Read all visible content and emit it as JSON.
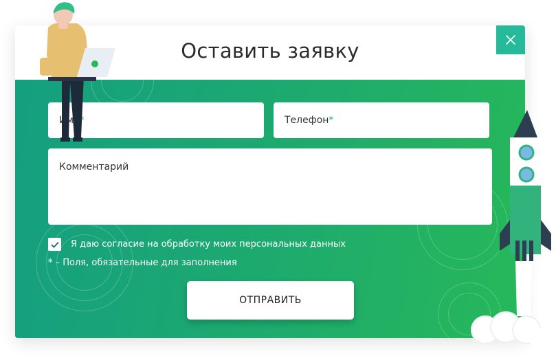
{
  "modal": {
    "title": "Оставить заявку",
    "close_icon": "close-icon"
  },
  "form": {
    "name_label": "Имя",
    "phone_label": "Телефон",
    "required_mark": "*",
    "comment_label": "Комментарий",
    "consent_checked": true,
    "consent_text": "Я даю согласие на обработку моих персональных данных",
    "required_note": "* –  Поля, обязательные для заполнения",
    "submit_label": "ОТПРАВИТЬ"
  },
  "colors": {
    "gradient_start": "#149f80",
    "gradient_end": "#27b859",
    "close_button": "#26b99a",
    "required_mark": "#27b859"
  },
  "illustrations": [
    "person-with-laptop",
    "rocket",
    "clouds"
  ]
}
